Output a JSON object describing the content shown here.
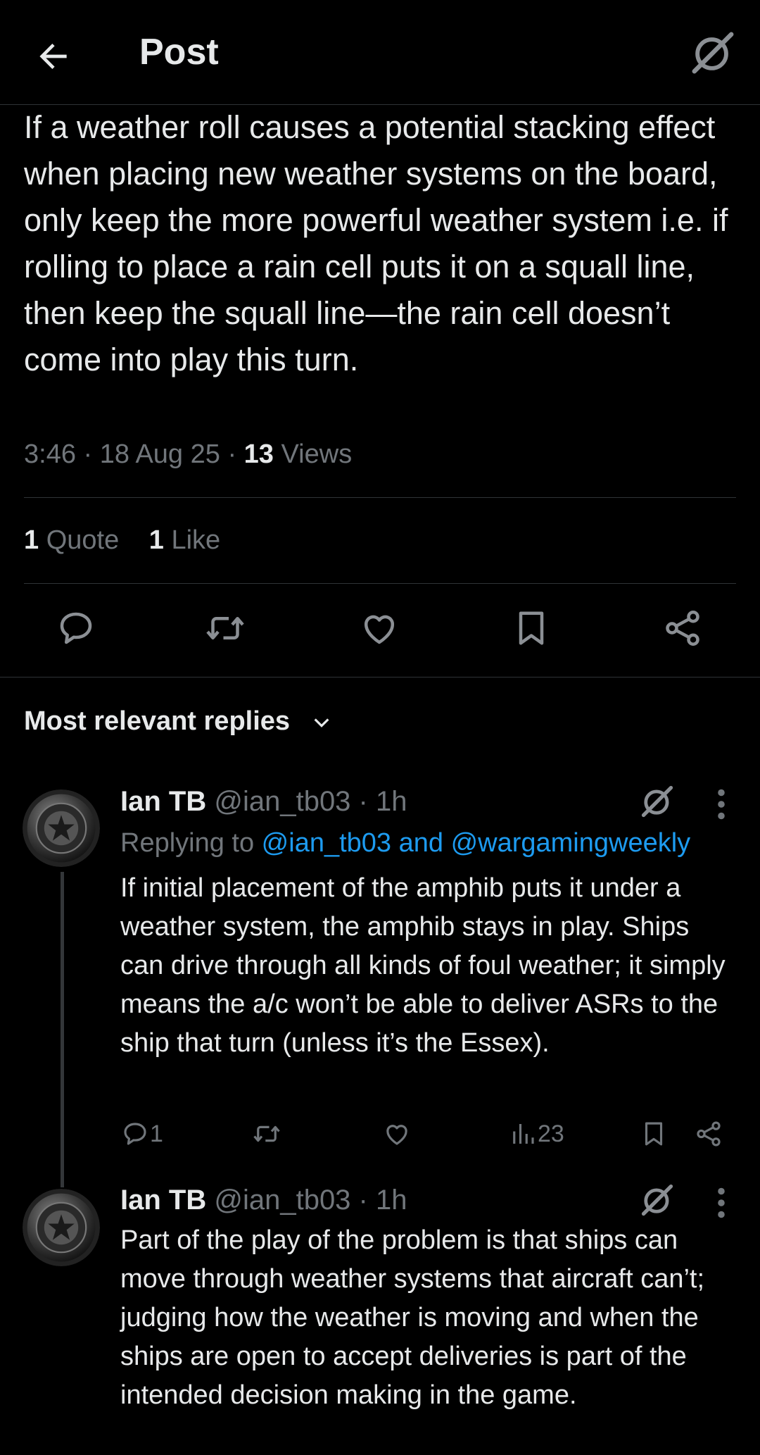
{
  "header": {
    "title": "Post"
  },
  "post": {
    "text": "If a weather roll causes a potential stacking effect when placing new weather systems on the board, only keep the more powerful weather system i.e. if rolling to place a rain cell puts it on a squall line, then keep the squall line—the rain cell doesn’t come into play this turn.",
    "time": "3:46 · 18 Aug 25 · ",
    "views_count": "13",
    "views_label": " Views",
    "quote_count": "1",
    "quote_label": " Quote",
    "like_count": "1",
    "like_label": " Like"
  },
  "replies_section": {
    "label": "Most relevant replies"
  },
  "replies": [
    {
      "name": "Ian TB",
      "handle": " @ian_tb03 · 1h",
      "replying_prefix": "Replying to ",
      "replying_mentions": "@ian_tb03 and @wargamingweekly",
      "text": "If initial placement of the amphib puts it under a weather system, the amphib stays in play. Ships can drive through all kinds of foul weather; it simply means the a/c won’t be able to deliver ASRs to the ship that turn (unless it’s the Essex).",
      "reply_count": "1",
      "view_count": "23"
    },
    {
      "name": "Ian TB",
      "handle": " @ian_tb03 · 1h",
      "text": "Part of the play of the problem is that ships can move through weather systems that aircraft can’t; judging how the weather is moving and when the ships are open to accept deliveries is part of the intended decision making in the game."
    }
  ],
  "colors": {
    "background": "#000000",
    "text": "#e7e9ea",
    "muted": "#71767b",
    "accent": "#1d9bf0",
    "divider": "#2f3336"
  },
  "icons": [
    "back-arrow-icon",
    "grok-icon",
    "reply-icon",
    "repost-icon",
    "like-icon",
    "bookmark-icon",
    "share-icon",
    "chevron-down-icon",
    "more-icon",
    "views-icon"
  ]
}
